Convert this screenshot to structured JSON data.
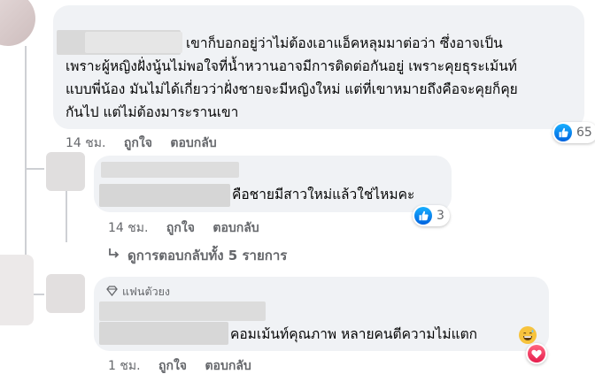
{
  "comment1": {
    "lines": [
      "เขาก็บอกอยู่ว่าไม่ต้องเอาแอ็คหลุมมาต่อว่า ซึ่งอาจเป็น",
      "เพราะผู้หญิงฝั่งนู้นไม่พอใจที่น้ำหวานอาจมีการติดต่อกันอยู่ เพราะคุยธุระเม้นท์",
      "แบบพี่น้อง มันไม่ได้เกี่ยวว่าฝั่งชายจะมีหญิงใหม่ แต่ที่เขาหมายถึงคือจะคุยก็คุย",
      "กันไป แต่ไม่ต้องมาระรานเขา"
    ],
    "time": "14 ชม.",
    "like": "ถูกใจ",
    "reply": "ตอบกลับ",
    "reaction_count": "65",
    "reaction_icon": "like-icon"
  },
  "comment2": {
    "text": "คือชายมีสาวใหม่แล้วใช่ไหมคะ",
    "time": "14 ชม.",
    "like": "ถูกใจ",
    "reply": "ตอบกลับ",
    "reaction_count": "3",
    "reaction_icon": "like-icon"
  },
  "view_replies": "ดูการตอบกลับทั้ง 5 รายการ",
  "comment3": {
    "badge": "แฟนตัวยง",
    "badge_icon": "diamond-icon",
    "text": "คอมเม้นท์คุณภาพ หลายคนตีความไม่แตก",
    "emoji": "grinning-sweat-emoji",
    "time": "1 ชม.",
    "like": "ถูกใจ",
    "reply": "ตอบกลับ",
    "reaction_icon": "heart-icon"
  },
  "colors": {
    "bubble": "#f0f2f5",
    "meta_text": "#65676b",
    "like_blue": "#0866ff",
    "heart_red": "#f33e58"
  }
}
